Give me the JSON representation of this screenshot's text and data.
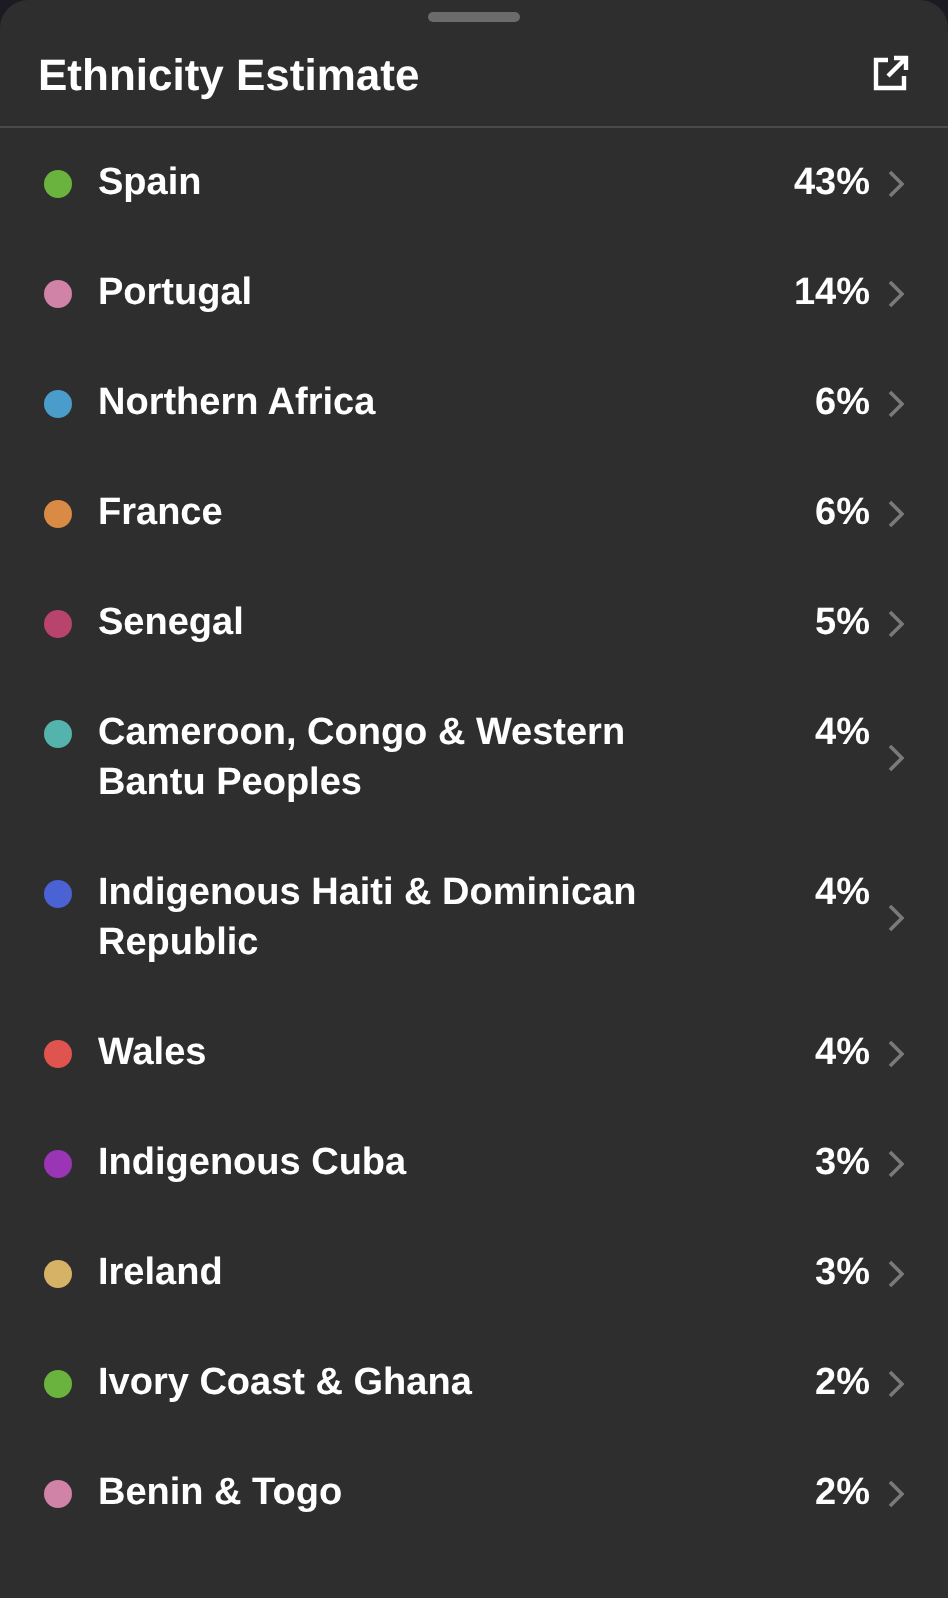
{
  "title": "Ethnicity Estimate",
  "regions": [
    {
      "name": "Spain",
      "percent": "43%",
      "color": "#6bb33f"
    },
    {
      "name": "Portugal",
      "percent": "14%",
      "color": "#d083a6"
    },
    {
      "name": "Northern Africa",
      "percent": "6%",
      "color": "#4a9ccb"
    },
    {
      "name": "France",
      "percent": "6%",
      "color": "#d98a45"
    },
    {
      "name": "Senegal",
      "percent": "5%",
      "color": "#b8436c"
    },
    {
      "name": "Cameroon, Congo & Western Bantu Peoples",
      "percent": "4%",
      "color": "#55b3ad"
    },
    {
      "name": "Indigenous Haiti & Dominican Republic",
      "percent": "4%",
      "color": "#4a62d3"
    },
    {
      "name": "Wales",
      "percent": "4%",
      "color": "#e0544f"
    },
    {
      "name": "Indigenous Cuba",
      "percent": "3%",
      "color": "#9a35b5"
    },
    {
      "name": "Ireland",
      "percent": "3%",
      "color": "#d6b266"
    },
    {
      "name": "Ivory Coast & Ghana",
      "percent": "2%",
      "color": "#6bb33f"
    },
    {
      "name": "Benin & Togo",
      "percent": "2%",
      "color": "#d083a6"
    }
  ]
}
